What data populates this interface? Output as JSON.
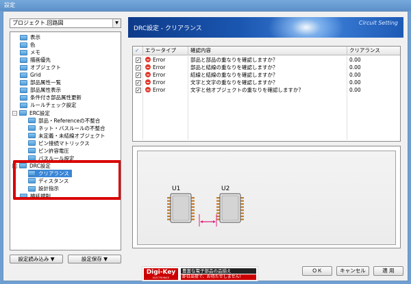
{
  "window": {
    "title": "設定"
  },
  "left": {
    "combo": "プロジェクト.回路図",
    "tree": [
      {
        "label": "表示",
        "depth": 1,
        "toggle": ""
      },
      {
        "label": "色",
        "depth": 1,
        "toggle": ""
      },
      {
        "label": "メモ",
        "depth": 1,
        "toggle": ""
      },
      {
        "label": "描画優先",
        "depth": 1,
        "toggle": ""
      },
      {
        "label": "オブジェクト",
        "depth": 1,
        "toggle": ""
      },
      {
        "label": "Grid",
        "depth": 1,
        "toggle": ""
      },
      {
        "label": "部品属性一覧",
        "depth": 1,
        "toggle": ""
      },
      {
        "label": "部品属性表示",
        "depth": 1,
        "toggle": ""
      },
      {
        "label": "条件付き部品属性更新",
        "depth": 1,
        "toggle": ""
      },
      {
        "label": "ルールチェック設定",
        "depth": 1,
        "toggle": ""
      },
      {
        "label": "ERC設定",
        "depth": 0,
        "toggle": "-"
      },
      {
        "label": "部品・Referenceの不整合",
        "depth": 2,
        "toggle": ""
      },
      {
        "label": "ネット・バスルールの不整合",
        "depth": 2,
        "toggle": ""
      },
      {
        "label": "未定義・未結線オブジェクト",
        "depth": 2,
        "toggle": ""
      },
      {
        "label": "ピン接続マトリックス",
        "depth": 2,
        "toggle": ""
      },
      {
        "label": "ピン許容電圧",
        "depth": 2,
        "toggle": ""
      },
      {
        "label": "バスルール設定",
        "depth": 2,
        "toggle": ""
      },
      {
        "label": "DRC設定",
        "depth": 0,
        "toggle": "-"
      },
      {
        "label": "クリアランス",
        "depth": 2,
        "toggle": "",
        "selected": true
      },
      {
        "label": "ディスタンス",
        "depth": 2,
        "toggle": ""
      },
      {
        "label": "設計指示",
        "depth": 2,
        "toggle": ""
      },
      {
        "label": "検証規則",
        "depth": 1,
        "toggle": ""
      }
    ],
    "load_button": "設定読み込み ▼",
    "save_button": "設定保存 ▼"
  },
  "header": {
    "title": "DRC設定 - クリアランス",
    "subtitle": "Circuit Setting"
  },
  "table": {
    "columns": [
      "✓",
      "エラータイプ",
      "確認内容",
      "クリアランス"
    ],
    "rows": [
      {
        "checked": "✓",
        "type": "Error",
        "content": "部品と部品の重なりを確認しますか？",
        "clearance": "0.00"
      },
      {
        "checked": "✓",
        "type": "Error",
        "content": "部品と結線の重なりを確認しますか？",
        "clearance": "0.00"
      },
      {
        "checked": "✓",
        "type": "Error",
        "content": "結線と結線の重なりを確認しますか？",
        "clearance": "0.00"
      },
      {
        "checked": "✓",
        "type": "Error",
        "content": "文字と文字の重なりを確認しますか？",
        "clearance": "0.00"
      },
      {
        "checked": "✓",
        "type": "Error",
        "content": "文字と他オブジェクトの重なりを確認しますか？",
        "clearance": "0.00"
      }
    ]
  },
  "preview": {
    "chip1": "U1",
    "chip2": "U2"
  },
  "ad": {
    "logo": "Digi-Key",
    "logo_sub": "ELECTRONICS",
    "line1": "豊富な電子部品の品揃え",
    "line2": "即日出荷で、お待たせしません!"
  },
  "buttons": {
    "ok": "ＯＫ",
    "cancel": "キャンセル",
    "apply": "適 用"
  },
  "colors": {
    "selection": "#3a86d6",
    "highlight": "#d90000",
    "error": "#e23a2e",
    "arrow": "#e0207a"
  }
}
